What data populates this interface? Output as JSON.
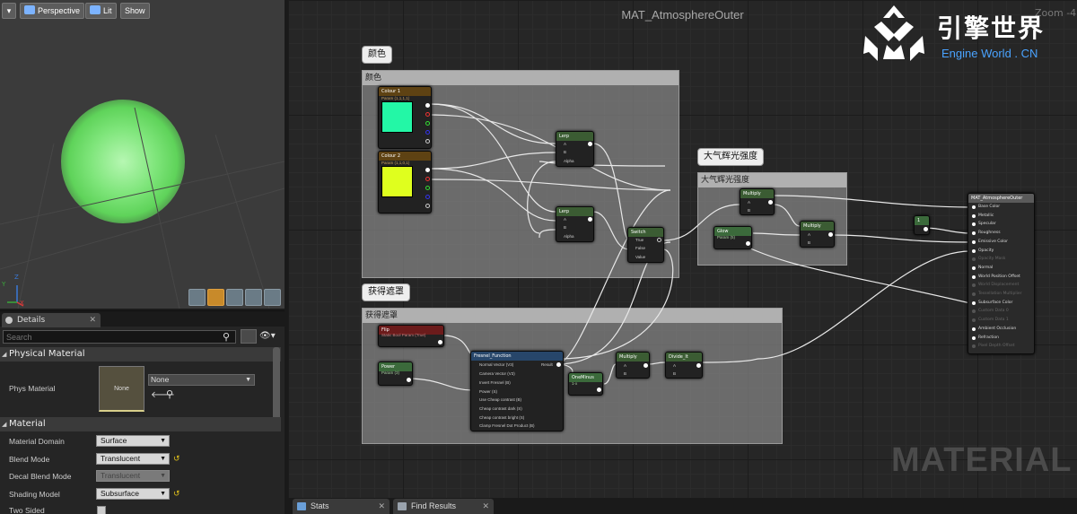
{
  "viewport": {
    "menu_arrow": "▾",
    "perspective_label": "Perspective",
    "lit_label": "Lit",
    "show_label": "Show",
    "axis_labels": {
      "x": "X",
      "y": "Y",
      "z": "Z"
    }
  },
  "details": {
    "tab_label": "Details",
    "tab_close": "✕",
    "search_placeholder": "Search",
    "sections": {
      "physical_material": "Physical Material",
      "material": "Material"
    },
    "phys_material": {
      "label": "Phys Material",
      "thumbnail_text": "None",
      "value": "None",
      "back_arrow": "🡐"
    },
    "properties": [
      {
        "label": "Material Domain",
        "value": "Surface",
        "enabled": true,
        "reset": false
      },
      {
        "label": "Blend Mode",
        "value": "Translucent",
        "enabled": true,
        "reset": true
      },
      {
        "label": "Decal Blend Mode",
        "value": "Translucent",
        "enabled": false,
        "reset": false
      },
      {
        "label": "Shading Model",
        "value": "Subsurface",
        "enabled": true,
        "reset": true
      },
      {
        "label": "Two Sided",
        "value": "",
        "enabled": true,
        "reset": false
      }
    ],
    "reset_icon": "↺"
  },
  "graph": {
    "title": "MAT_AtmosphereOuter",
    "zoom_label": "Zoom -4",
    "watermark": "MATERIAL",
    "comments": {
      "color": {
        "bubble": "颜色",
        "header": "颜色"
      },
      "glow": {
        "bubble": "大气辉光强度",
        "header": "大气辉光强度"
      },
      "mask": {
        "bubble": "获得遮罩",
        "header": "获得遮罩"
      }
    },
    "nodes": {
      "colour1": {
        "title": "Colour 1",
        "subtitle": "Param (1,1,1,1)"
      },
      "colour2": {
        "title": "Colour 2",
        "subtitle": "Param (1,1,0,1)"
      },
      "lerp1": {
        "title": "Lerp",
        "pins": [
          "A",
          "B",
          "Alpha"
        ]
      },
      "lerp2": {
        "title": "Lerp",
        "pins": [
          "A",
          "B",
          "Alpha"
        ]
      },
      "switch": {
        "title": "Switch",
        "pins": [
          "True",
          "False",
          "Value"
        ]
      },
      "multiply1": {
        "title": "Multiply",
        "pins": [
          "A",
          "B"
        ]
      },
      "glow": {
        "title": "Glow",
        "subtitle": "Param (5)"
      },
      "multiply2": {
        "title": "Multiply",
        "pins": [
          "A",
          "B"
        ]
      },
      "constant": {
        "title": "1"
      },
      "flip": {
        "title": "Flip",
        "subtitle": "Static Bool Param (True)"
      },
      "power": {
        "title": "Power",
        "subtitle": "Param (3)"
      },
      "fresnel": {
        "title": "Fresnel_Function",
        "result": "Result",
        "pins": [
          "Normal Vector (V3)",
          "Camera Vector (V3)",
          "Invert Fresnel (B)",
          "Power (S)",
          "Use Cheap contrast (B)",
          "Cheap contrast dark (S)",
          "Cheap contrast bright (S)",
          "Clamp Fresnel Dot Product (B)"
        ]
      },
      "oneminus": {
        "title": "OneMinus",
        "subtitle": "1-x"
      },
      "multiply3": {
        "title": "Multiply",
        "pins": [
          "A",
          "B"
        ]
      },
      "divide": {
        "title": "Divide_lt",
        "pins": [
          "A",
          "B"
        ]
      },
      "result": {
        "title": "MAT_AtmosphereOuter",
        "pins": [
          "Base Color",
          "Metallic",
          "Specular",
          "Roughness",
          "Emissive Color",
          "Opacity",
          "Opacity Mask",
          "Normal",
          "World Position Offset",
          "World Displacement",
          "Tessellation Multiplier",
          "Subsurface Color",
          "Custom Data 0",
          "Custom Data 1",
          "Ambient Occlusion",
          "Refraction",
          "Pixel Depth Offset"
        ]
      }
    }
  },
  "logo": {
    "cn": "引擎世界",
    "en": "Engine World . CN"
  },
  "bottom_tabs": [
    {
      "label": "Stats"
    },
    {
      "label": "Find Results"
    }
  ],
  "colors": {
    "colour1_swatch": "#23f7a6",
    "colour2_swatch": "#dfff1e",
    "param_header": "#5e4213",
    "lerp_header": "#3b5c33",
    "function_header": "#27466a",
    "result_header": "#5a5a5a",
    "flip_header": "#6b1b1b",
    "logo_blue": "#4aa3ff"
  }
}
